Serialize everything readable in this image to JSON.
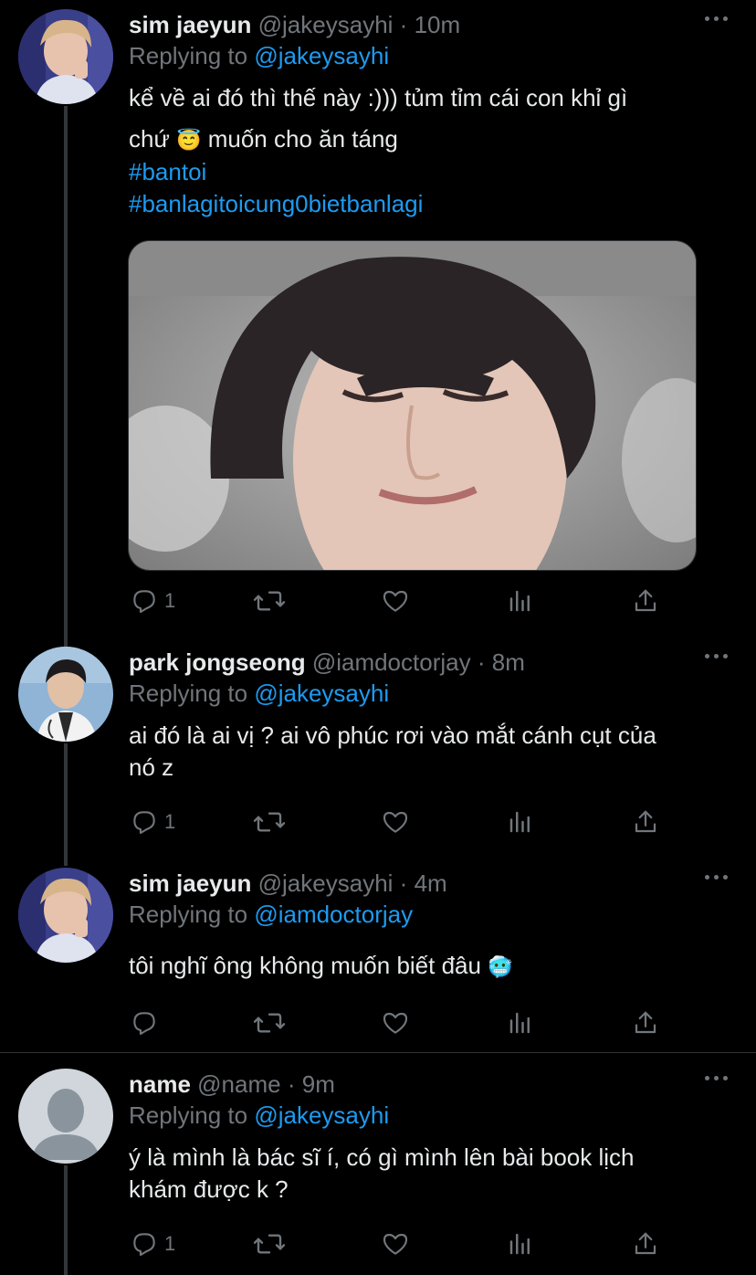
{
  "tweets": [
    {
      "name": "sim jaeyun",
      "handle": "@jakeysayhi",
      "sep": "·",
      "time": "10m",
      "replying_prefix": "Replying to ",
      "replying_to": "@jakeysayhi",
      "text_line1": "kể về ai đó thì thế này :))) tủm tỉm cái con khỉ gì",
      "text_line2_a": "chứ ",
      "emoji": "😇",
      "text_line2_b": "  muốn cho ăn táng",
      "hashtags": [
        "#bantoi",
        "#banlagitoicung0bietbanlagi"
      ],
      "reply_count": "1"
    },
    {
      "name": "park jongseong",
      "handle": "@iamdoctorjay",
      "sep": "·",
      "time": "8m",
      "replying_prefix": "Replying to ",
      "replying_to": "@jakeysayhi",
      "text_line1": "ai đó là ai vị ? ai vô phúc rơi vào mắt cánh cụt của",
      "text_line2": "nó z",
      "reply_count": "1"
    },
    {
      "name": "sim jaeyun",
      "handle": "@jakeysayhi",
      "sep": "·",
      "time": "4m",
      "replying_prefix": "Replying to ",
      "replying_to": "@iamdoctorjay",
      "text_line1": "tôi nghĩ ông không muốn biết đâu ",
      "emoji": "🥶",
      "reply_count": ""
    },
    {
      "name": "name",
      "handle": "@name",
      "sep": "·",
      "time": "9m",
      "replying_prefix": "Replying to ",
      "replying_to": "@jakeysayhi",
      "text_line1": "ý là mình là bác sĩ í, có gì mình lên bài book lịch",
      "text_line2": "khám được k ?",
      "reply_count": "1"
    }
  ],
  "icons": {
    "reply": "reply-icon",
    "retweet": "retweet-icon",
    "like": "heart-icon",
    "views": "views-icon",
    "share": "share-icon",
    "more": "more-icon"
  },
  "colors": {
    "background": "#000000",
    "text": "#e7e9ea",
    "muted": "#71767b",
    "accent": "#1d9bf0",
    "line": "#333639"
  }
}
